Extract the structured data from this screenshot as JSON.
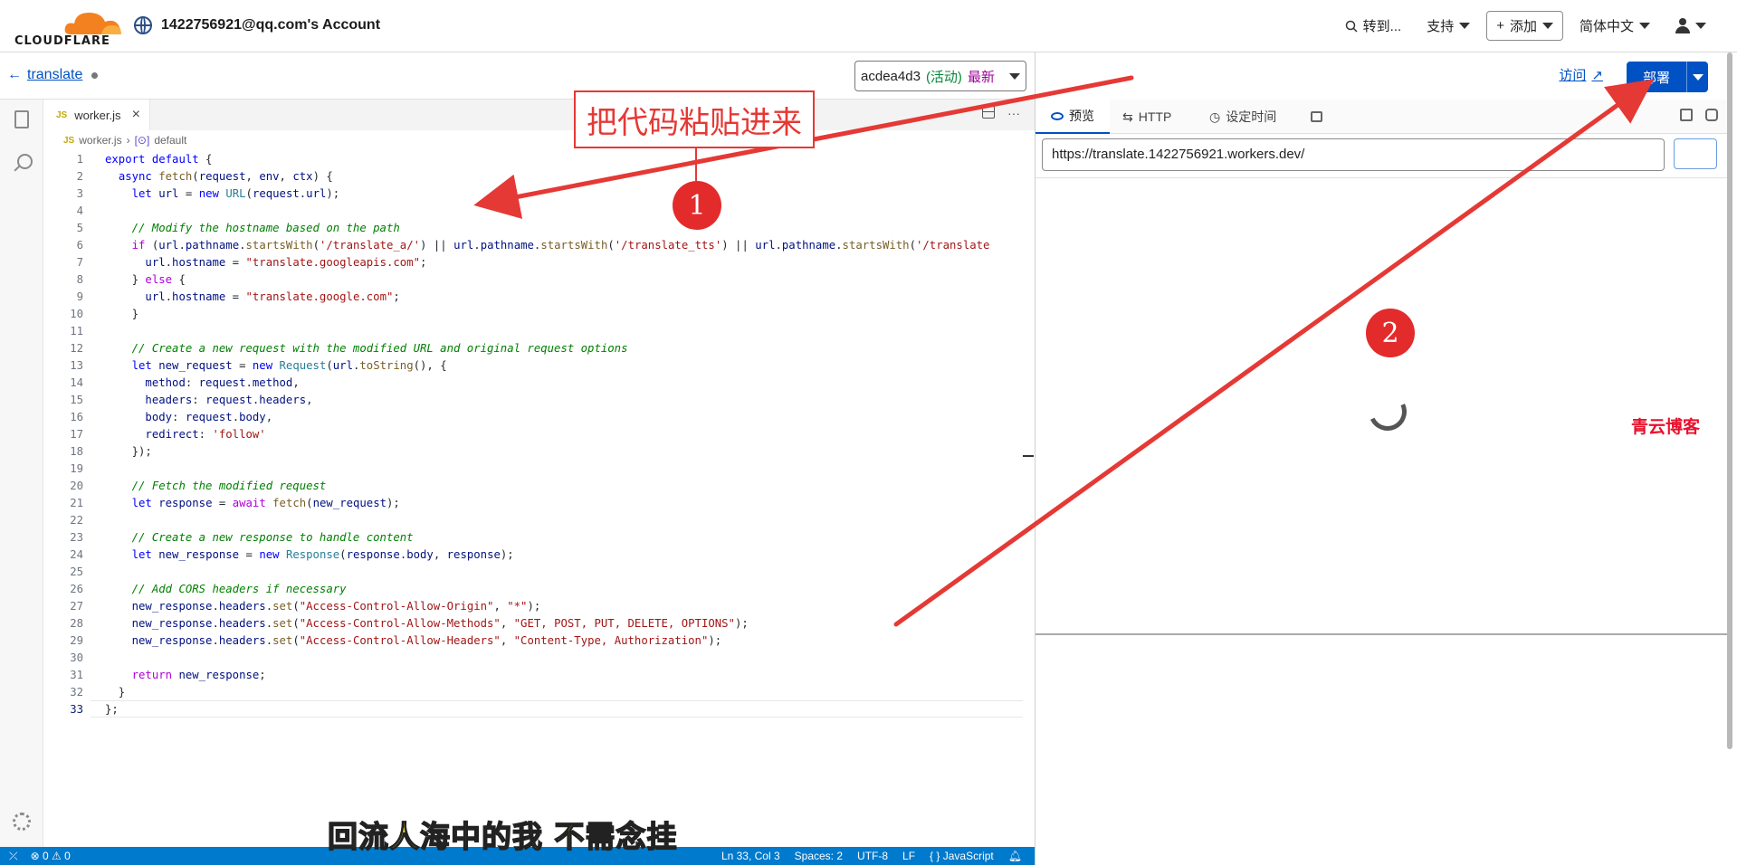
{
  "header": {
    "logo_text": "CLOUDFLARE",
    "account": "1422756921@qq.com's Account",
    "nav": {
      "goto": "转到...",
      "support": "支持",
      "add": "添加",
      "language": "简体中文"
    }
  },
  "worker": {
    "name": "translate",
    "version_id": "acdea4d3",
    "version_status": "(活动)",
    "version_latest": "最新",
    "visit": "访问",
    "deploy": "部署"
  },
  "editor": {
    "tab_badge": "JS",
    "tab_name": "worker.js",
    "breadcrumb_file": "worker.js",
    "breadcrumb_symbol": "default",
    "status": {
      "problems": "⊗ 0 ⚠ 0",
      "position": "Ln 33, Col 3",
      "spaces": "Spaces: 2",
      "encoding": "UTF-8",
      "eol": "LF",
      "language": "{ } JavaScript"
    }
  },
  "preview": {
    "tabs": [
      "预览",
      "HTTP",
      "设定时间"
    ],
    "url": "https://translate.1422756921.workers.dev/"
  },
  "annotations": {
    "callout_text": "把代码粘贴进来",
    "badge1": "1",
    "badge2": "2",
    "watermark": "青云博客",
    "subtitle": "回流人海中的我 不需念挂",
    "color": "#e53935"
  },
  "icons": [
    "globe-icon",
    "search-icon",
    "caret-down-icon",
    "user-icon",
    "back-arrow-icon",
    "files-icon",
    "settings-icon",
    "close-icon",
    "eye-icon",
    "external-link-icon",
    "clock-icon",
    "terminal-icon"
  ]
}
